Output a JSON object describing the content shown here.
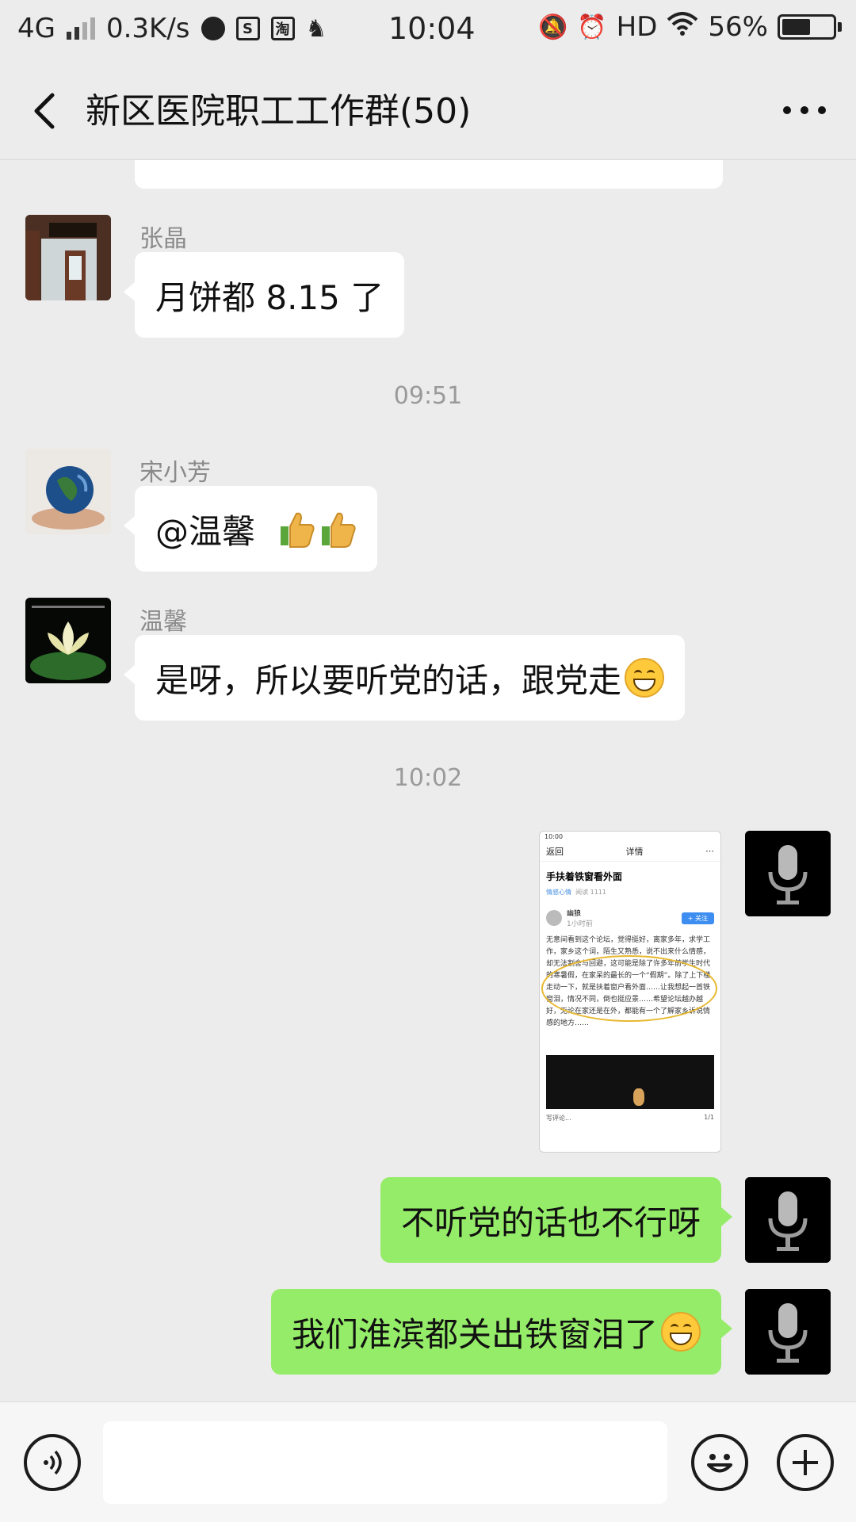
{
  "status_bar": {
    "network": "4G",
    "speed": "0.3K/s",
    "time": "10:04",
    "hd": "HD",
    "battery": "56%",
    "battery_level": 0.56
  },
  "header": {
    "title": "新区医院职工工作群(50)"
  },
  "messages": [
    {
      "type": "text",
      "side": "left",
      "sender": "张晶",
      "text": "月饼都 8.15 了"
    },
    {
      "type": "time",
      "text": "09:51"
    },
    {
      "type": "text",
      "side": "left",
      "sender": "宋小芳",
      "text": "@温馨"
    },
    {
      "type": "text",
      "side": "left",
      "sender": "温馨",
      "text": "是呀，所以要听党的话，跟党走"
    },
    {
      "type": "time",
      "text": "10:02"
    },
    {
      "type": "image",
      "side": "right"
    },
    {
      "type": "text",
      "side": "right",
      "text": "不听党的话也不行呀"
    },
    {
      "type": "text",
      "side": "right",
      "text": "我们淮滨都关出铁窗泪了"
    }
  ],
  "shared_image": {
    "time": "10:00",
    "back": "返回",
    "nav_title": "详情",
    "article_title": "手扶着铁窗看外面",
    "tag": "情感心情",
    "reads": "阅读 1111",
    "author": "幽狼",
    "author_time": "1小时前",
    "follow": "+ 关注",
    "body": "无意间看到这个论坛，觉得挺好，离家多年，求学工作，家乡这个词，陌生又熟悉，说不出来什么情感，却无法割舍与回避，这可能是除了许多年前学生时代的寒暑假，在家呆的最长的一个“假期”。除了上下楼走动一下，就是扶着窗户看外面……让我想起一首铁窗泪，情况不同，倒也挺应景……希望论坛越办越好，无论在家还是在外，都能有一个了解家乡诉说情感的地方……",
    "comment": "写评论...",
    "page": "1/1"
  },
  "icons": {
    "back": "back-arrow-icon",
    "more": "more-dots-icon",
    "voice": "voice-input-icon",
    "emoji": "emoji-icon",
    "plus": "plus-icon"
  },
  "colors": {
    "background": "#ececec",
    "bubble_left": "#ffffff",
    "bubble_right": "#95ec69"
  }
}
